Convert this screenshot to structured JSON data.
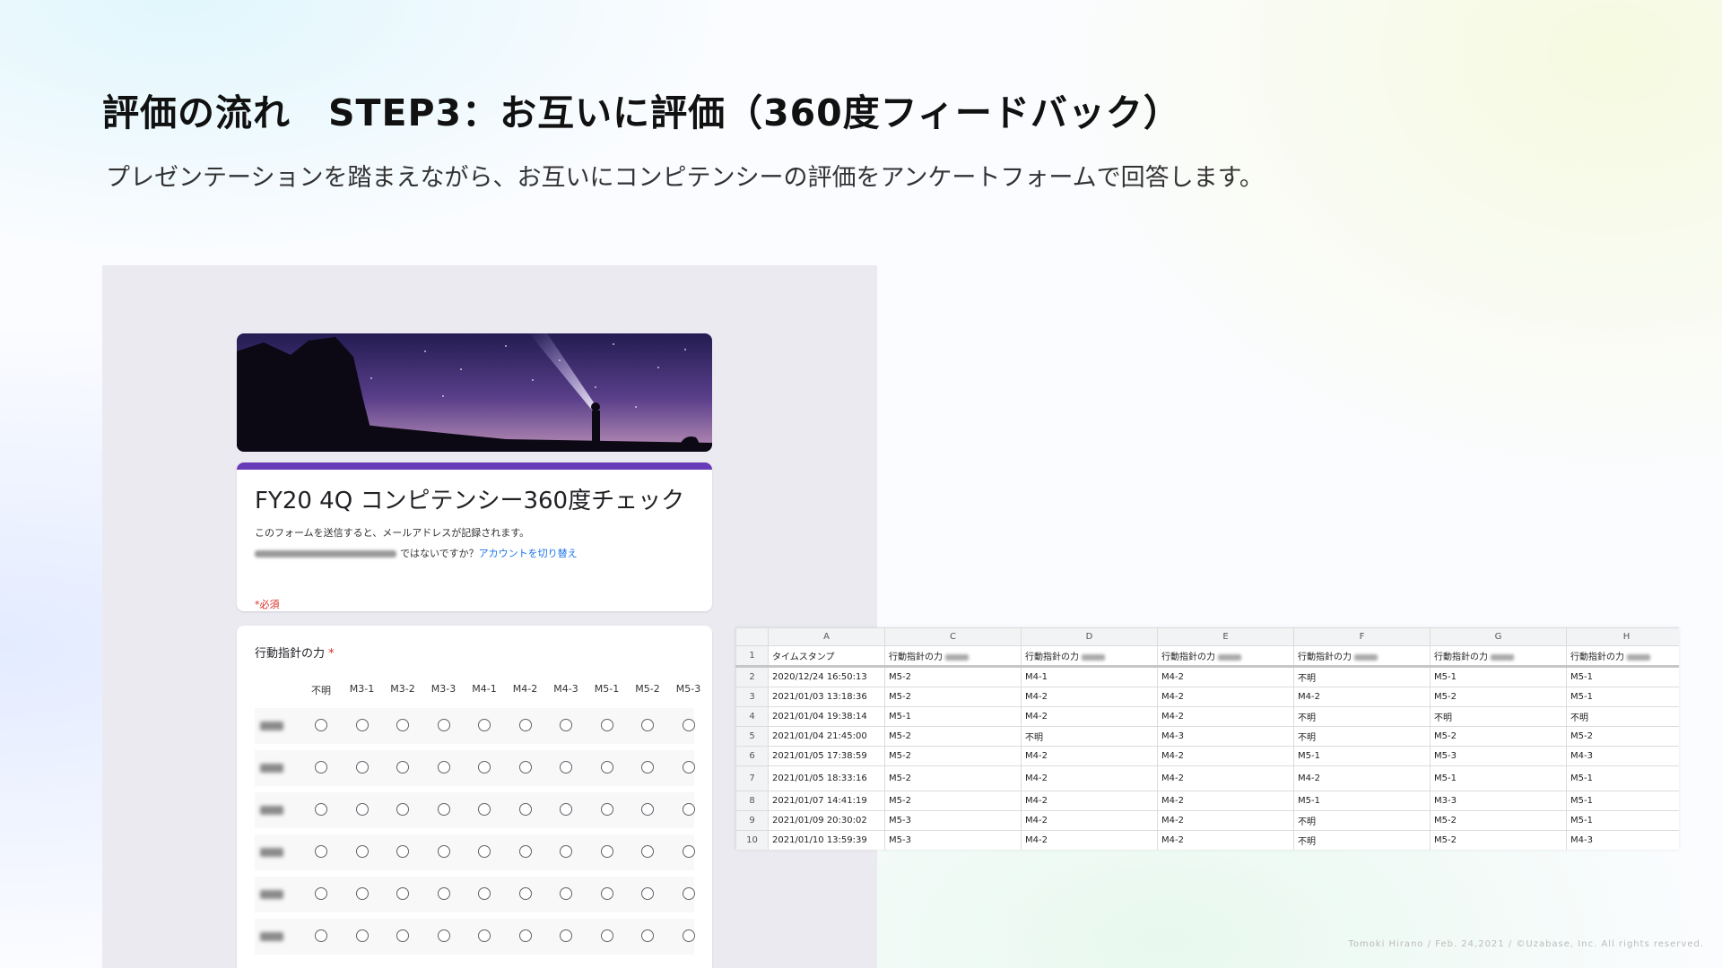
{
  "slide": {
    "title": "評価の流れ　STEP3：お互いに評価（360度フィードバック）",
    "subtitle": "プレゼンテーションを踏まえながら、お互いにコンピテンシーの評価をアンケートフォームで回答します。",
    "footer": "Tomoki Hirano / Feb. 24,2021 / ©Uzabase, Inc. All rights reserved."
  },
  "form": {
    "title": "FY20 4Q コンピテンシー360度チェック",
    "notice": "このフォームを送信すると、メールアドレスが記録されます。",
    "not_you": "ではないですか？",
    "switch_account": "アカウントを切り替え",
    "required_note": "*必須",
    "question": {
      "label": "行動指針の力",
      "required_star": "*",
      "columns": [
        "不明",
        "M3-1",
        "M3-2",
        "M3-3",
        "M4-1",
        "M4-2",
        "M4-3",
        "M5-1",
        "M5-2",
        "M5-3"
      ],
      "row_count": 6
    }
  },
  "sheet": {
    "col_letters": [
      "A",
      "C",
      "D",
      "E",
      "F",
      "G",
      "H"
    ],
    "row_numbers": [
      "1",
      "2",
      "3",
      "4",
      "5",
      "6",
      "7",
      "8",
      "9",
      "10"
    ],
    "header_row": [
      "タイムスタンプ",
      "行動指針の力",
      "行動指針の力",
      "行動指針の力",
      "行動指針の力",
      "行動指針の力",
      "行動指針の力"
    ],
    "rows": [
      [
        "2020/12/24 16:50:13",
        "M5-2",
        "M4-1",
        "M4-2",
        "不明",
        "M5-1",
        "M5-1"
      ],
      [
        "2021/01/03 13:18:36",
        "M5-2",
        "M4-2",
        "M4-2",
        "M4-2",
        "M5-2",
        "M5-1"
      ],
      [
        "2021/01/04 19:38:14",
        "M5-1",
        "M4-2",
        "M4-2",
        "不明",
        "不明",
        "不明"
      ],
      [
        "2021/01/04 21:45:00",
        "M5-2",
        "不明",
        "M4-3",
        "不明",
        "M5-2",
        "M5-2"
      ],
      [
        "2021/01/05 17:38:59",
        "M5-2",
        "M4-2",
        "M4-2",
        "M5-1",
        "M5-3",
        "M4-3"
      ],
      [
        "2021/01/05 18:33:16",
        "M5-2",
        "M4-2",
        "M4-2",
        "M4-2",
        "M5-1",
        "M5-1"
      ],
      [
        "2021/01/07 14:41:19",
        "M5-2",
        "M4-2",
        "M4-2",
        "M5-1",
        "M3-3",
        "M5-1"
      ],
      [
        "2021/01/09 20:30:02",
        "M5-3",
        "M4-2",
        "M4-2",
        "不明",
        "M5-2",
        "M5-1"
      ],
      [
        "2021/01/10 13:59:39",
        "M5-3",
        "M4-2",
        "M4-2",
        "不明",
        "M5-2",
        "M4-3"
      ]
    ]
  }
}
